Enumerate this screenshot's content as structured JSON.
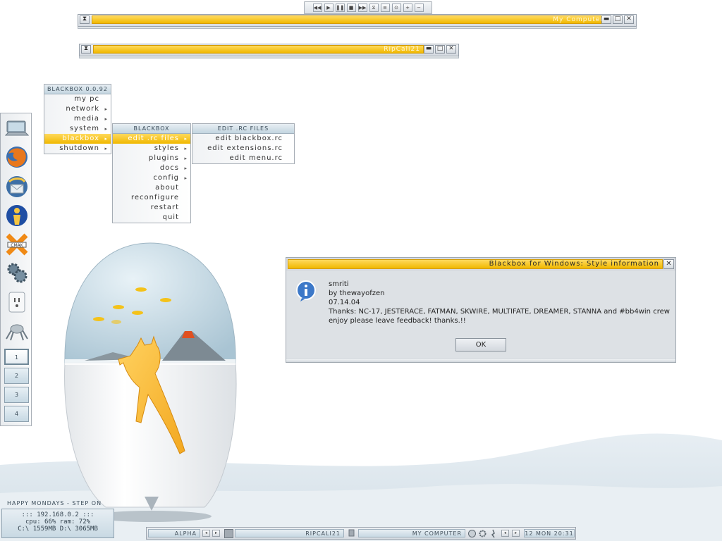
{
  "media_bar": {
    "buttons": [
      {
        "glyph": "◀◀",
        "name": "prev-icon"
      },
      {
        "glyph": "▶",
        "name": "play-icon"
      },
      {
        "glyph": "❚❚",
        "name": "pause-icon"
      },
      {
        "glyph": "■",
        "name": "stop-icon"
      },
      {
        "glyph": "▶▶",
        "name": "next-icon"
      },
      {
        "glyph": "⧖",
        "name": "shuffle-icon"
      },
      {
        "glyph": "≡",
        "name": "playlist-icon"
      },
      {
        "glyph": "⊙",
        "name": "repeat-icon"
      },
      {
        "glyph": "+",
        "name": "volume-up-icon"
      },
      {
        "glyph": "−",
        "name": "volume-down-icon"
      }
    ]
  },
  "windows": {
    "my_computer": {
      "title": "My Computer"
    },
    "ripcali": {
      "title": "RipCali21"
    },
    "minimize_glyph": "▬",
    "maximize_glyph": "□",
    "close_glyph": "✕",
    "shade_glyph": "⧗"
  },
  "menus": {
    "root": {
      "title": "BLACKBOX 0.0.92",
      "items": [
        {
          "label": "my pc",
          "submenu": false,
          "active": false
        },
        {
          "label": "network",
          "submenu": true,
          "active": false
        },
        {
          "label": "media",
          "submenu": true,
          "active": false
        },
        {
          "label": "system",
          "submenu": true,
          "active": false
        },
        {
          "label": "blackbox",
          "submenu": true,
          "active": true
        },
        {
          "label": "shutdown",
          "submenu": true,
          "active": false
        }
      ]
    },
    "blackbox": {
      "title": "BLACKBOX",
      "items": [
        {
          "label": "edit .rc files",
          "submenu": true,
          "active": true
        },
        {
          "label": "styles",
          "submenu": true,
          "active": false
        },
        {
          "label": "plugins",
          "submenu": true,
          "active": false
        },
        {
          "label": "docs",
          "submenu": true,
          "active": false
        },
        {
          "label": "config",
          "submenu": true,
          "active": false
        },
        {
          "label": "about",
          "submenu": false,
          "active": false
        },
        {
          "label": "reconfigure",
          "submenu": false,
          "active": false
        },
        {
          "label": "restart",
          "submenu": false,
          "active": false
        },
        {
          "label": "quit",
          "submenu": false,
          "active": false
        }
      ]
    },
    "rc_files": {
      "title": "EDIT .RC FILES",
      "items": [
        {
          "label": "edit blackbox.rc",
          "submenu": false,
          "active": false
        },
        {
          "label": "edit extensions.rc",
          "submenu": false,
          "active": false
        },
        {
          "label": "edit menu.rc",
          "submenu": false,
          "active": false
        }
      ]
    },
    "arrow_glyph": "▸"
  },
  "dock": {
    "icons": [
      "computer-icon",
      "firefox-icon",
      "thunderbird-icon",
      "messenger-icon",
      "crossover-icon",
      "settings-gears-icon",
      "power-outlet-icon",
      "spider-icon"
    ],
    "desktops": [
      "1",
      "2",
      "3",
      "4"
    ],
    "active_desktop": "1"
  },
  "dialog": {
    "title": "Blackbox for Windows: Style information",
    "close_glyph": "✕",
    "info_glyph": "i",
    "lines": [
      "smriti",
      "by thewayofzen",
      "07.14.04",
      "Thanks: NC-17, JESTERACE, FATMAN, SKWIRE, MULTIFATE, DREAMER, STANNA and #bb4win crew",
      "enjoy please leave feedback! thanks.!!"
    ],
    "ok_label": "OK"
  },
  "sysinfo": {
    "tagline": "HAPPY MONDAYS - STEP ON",
    "ip": "::: 192.168.0.2 :::",
    "cpu_ram": "cpu: 66%    ram: 72%",
    "drives": "C:\\ 1559MB  D:\\ 3065MB"
  },
  "taskbar": {
    "workspace": "ALPHA",
    "task1": "RIPCALI21",
    "task2": "MY COMPUTER",
    "clock": "12 MON 20:31",
    "left_glyph": "◂",
    "right_glyph": "▸"
  },
  "colors": {
    "accent_yellow": "#f0b800",
    "accent_blue": "#c3d5e0",
    "chrome_gray": "#d6dbe1"
  }
}
